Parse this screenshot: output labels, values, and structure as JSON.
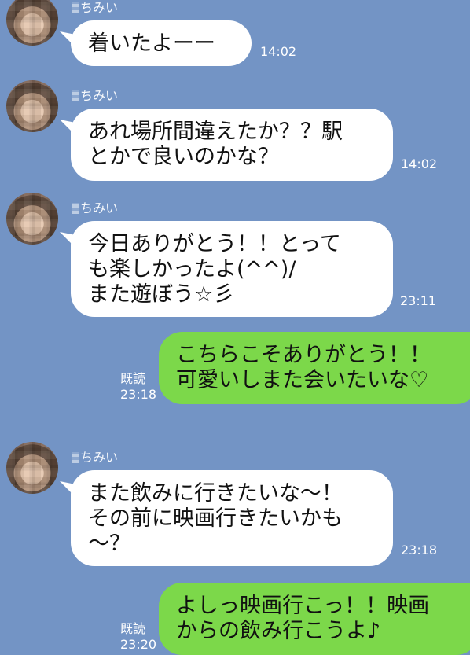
{
  "contact": {
    "name": "ちみい"
  },
  "messages": [
    {
      "direction": "incoming",
      "text": "着いたよーー",
      "time": "14:02"
    },
    {
      "direction": "incoming",
      "text": "あれ場所間違えたか？？駅\nとかで良いのかな？",
      "time": "14:02"
    },
    {
      "direction": "incoming",
      "text": "今日ありがとう！！とって\nも楽しかったよ(^^)/\nまた遊ぼう☆彡",
      "time": "23:11"
    },
    {
      "direction": "outgoing",
      "text": "こちらこそありがとう！！\n可愛いしまた会いたいな♡",
      "read": "既読",
      "time": "23:18"
    },
    {
      "direction": "incoming",
      "text": "また飲みに行きたいな〜！\nその前に映画行きたいかも\n〜？",
      "time": "23:18"
    },
    {
      "direction": "outgoing",
      "text": "よしっ映画行こっ！！映画\nからの飲み行こうよ♪",
      "read": "既読",
      "time": "23:20"
    }
  ]
}
